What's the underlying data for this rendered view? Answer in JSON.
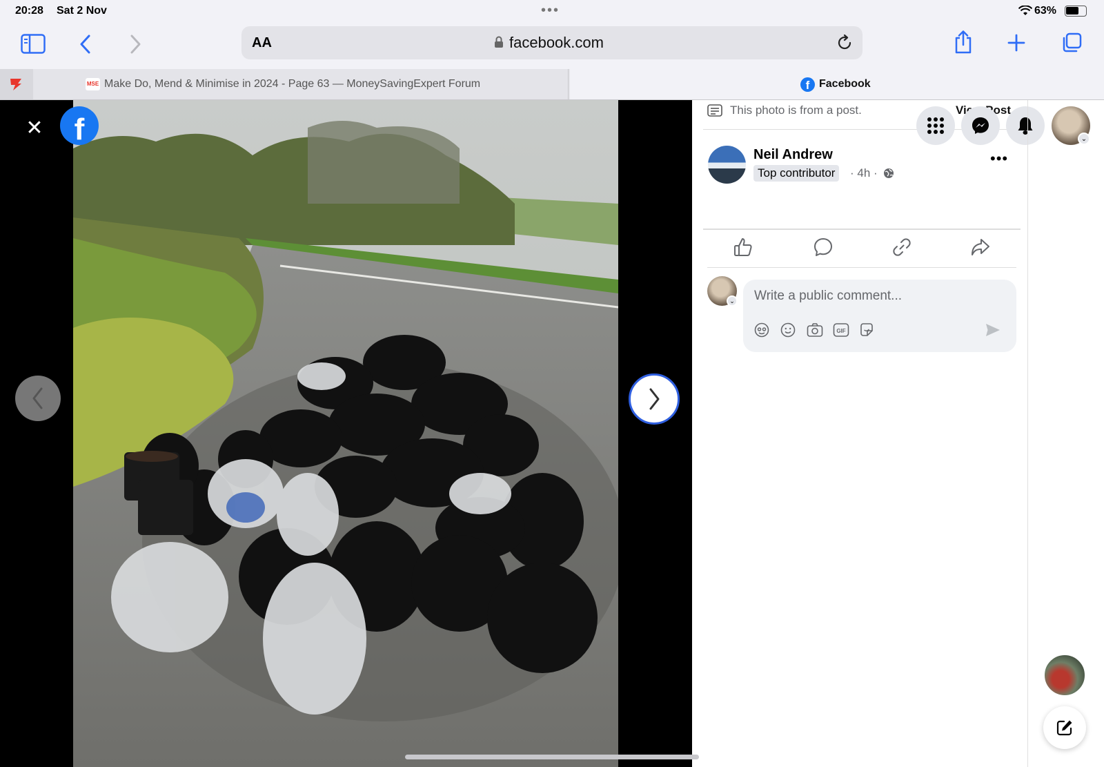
{
  "status": {
    "time": "20:28",
    "date": "Sat 2 Nov",
    "battery_pct": "63%"
  },
  "toolbar": {
    "text_size_label": "AA",
    "url": "facebook.com"
  },
  "tabs": [
    {
      "title": "Make Do, Mend & Minimise in 2024 - Page 63 — MoneySavingExpert Forum",
      "favicon": "MSE",
      "active": false
    },
    {
      "title": "Facebook",
      "active": true
    }
  ],
  "post": {
    "from_post_note": "This photo is from a post.",
    "view_post_label": "View Post",
    "author": "Neil Andrew",
    "badge": "Top contributor",
    "meta": "· 4h ·",
    "comment_placeholder": "Write a public comment..."
  },
  "colors": {
    "fb_blue": "#1877f2",
    "accent_blue": "#2f6df6"
  }
}
